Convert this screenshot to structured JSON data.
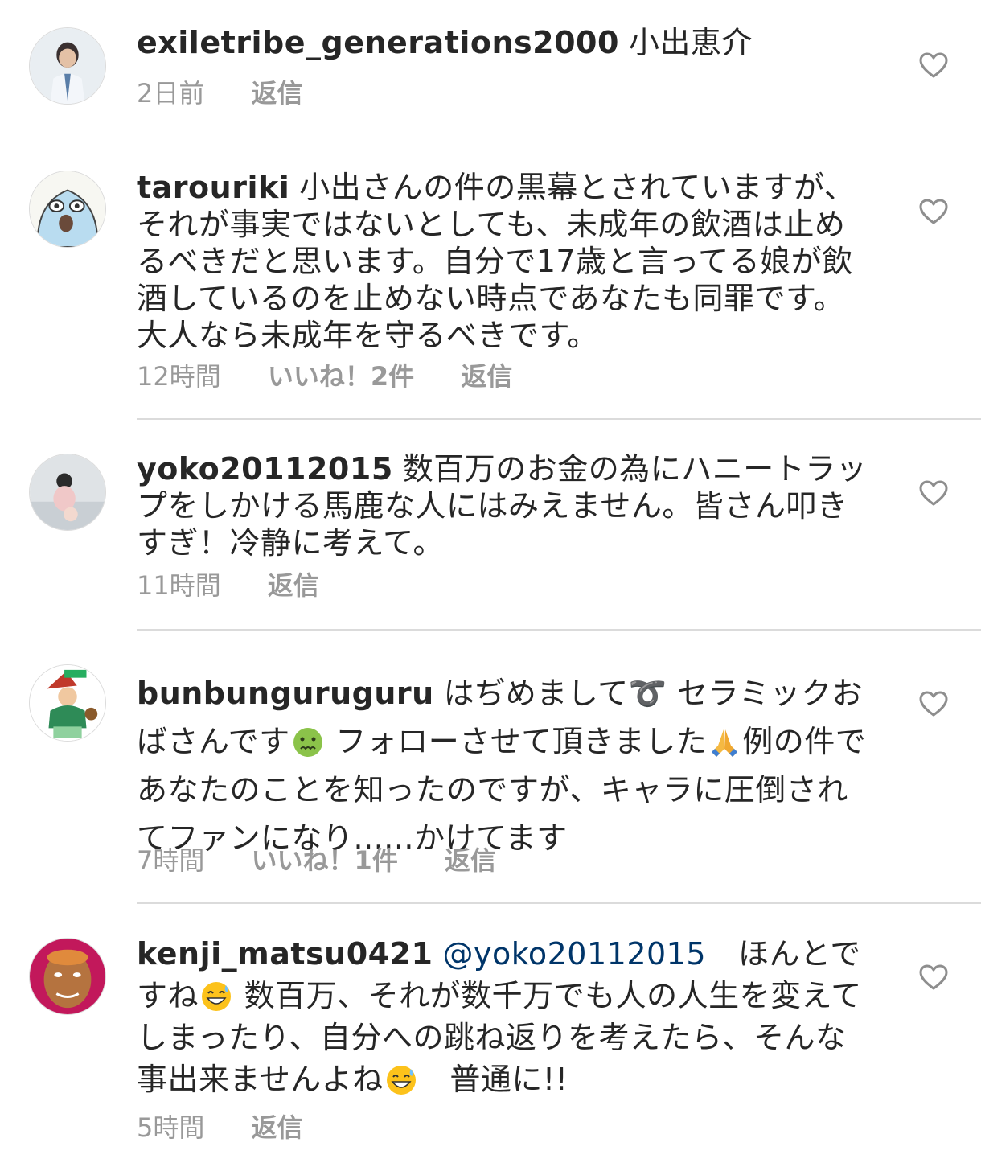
{
  "comments": [
    {
      "username": "exiletribe_generations2000",
      "text_parts": [
        "小出恵介"
      ],
      "time": "2日前",
      "likes": "",
      "reply": "返信"
    },
    {
      "username": "tarouriki",
      "text_parts": [
        "小出さんの件の黒幕とされていますが、それが事実ではないとしても、未成年の飲酒は止めるべきだと思います。自分で17歳と言ってる娘が飲酒しているのを止めない時点であなたも同罪です。大人なら未成年を守るべきです。"
      ],
      "time": "12時間",
      "likes": "いいね！2件",
      "reply": "返信"
    },
    {
      "username": "yoko20112015",
      "text_parts": [
        "数百万のお金の為にハニートラップをしかける馬鹿な人にはみえません。皆さん叩きすぎ！冷静に考えて。"
      ],
      "time": "11時間",
      "likes": "",
      "reply": "返信"
    },
    {
      "username": "bunbunguruguru",
      "text_parts": [
        "はぢめまして",
        "➰",
        " セラミックおばさんです",
        "🤢",
        " フォローさせて頂きました",
        "🙏",
        "例の件であなたのことを知ったのですが、キャラに圧倒されてファンになり......かけてます"
      ],
      "time": "7時間",
      "likes": "いいね！1件",
      "reply": "返信"
    },
    {
      "username": "kenji_matsu0421",
      "mention": "@yoko20112015",
      "text_parts": [
        "ほんとですね",
        "😅",
        " 数百万、それが数千万でも人の人生を変えてしまったり、自分への跳ね返りを考えたら、そんな事出来ませんよね",
        "😅",
        "　普通に!!"
      ],
      "time": "5時間",
      "likes": "",
      "reply": "返信"
    }
  ],
  "icons": {
    "like": "heart-outline-icon",
    "emoji_1": "curly-loop-emoji",
    "emoji_2": "nauseated-face-emoji",
    "emoji_3": "folded-hands-emoji",
    "emoji_4": "grinning-sweat-emoji"
  },
  "colors": {
    "text": "#262626",
    "meta": "#999999",
    "mention": "#003569",
    "divider": "#dbdbdb"
  }
}
